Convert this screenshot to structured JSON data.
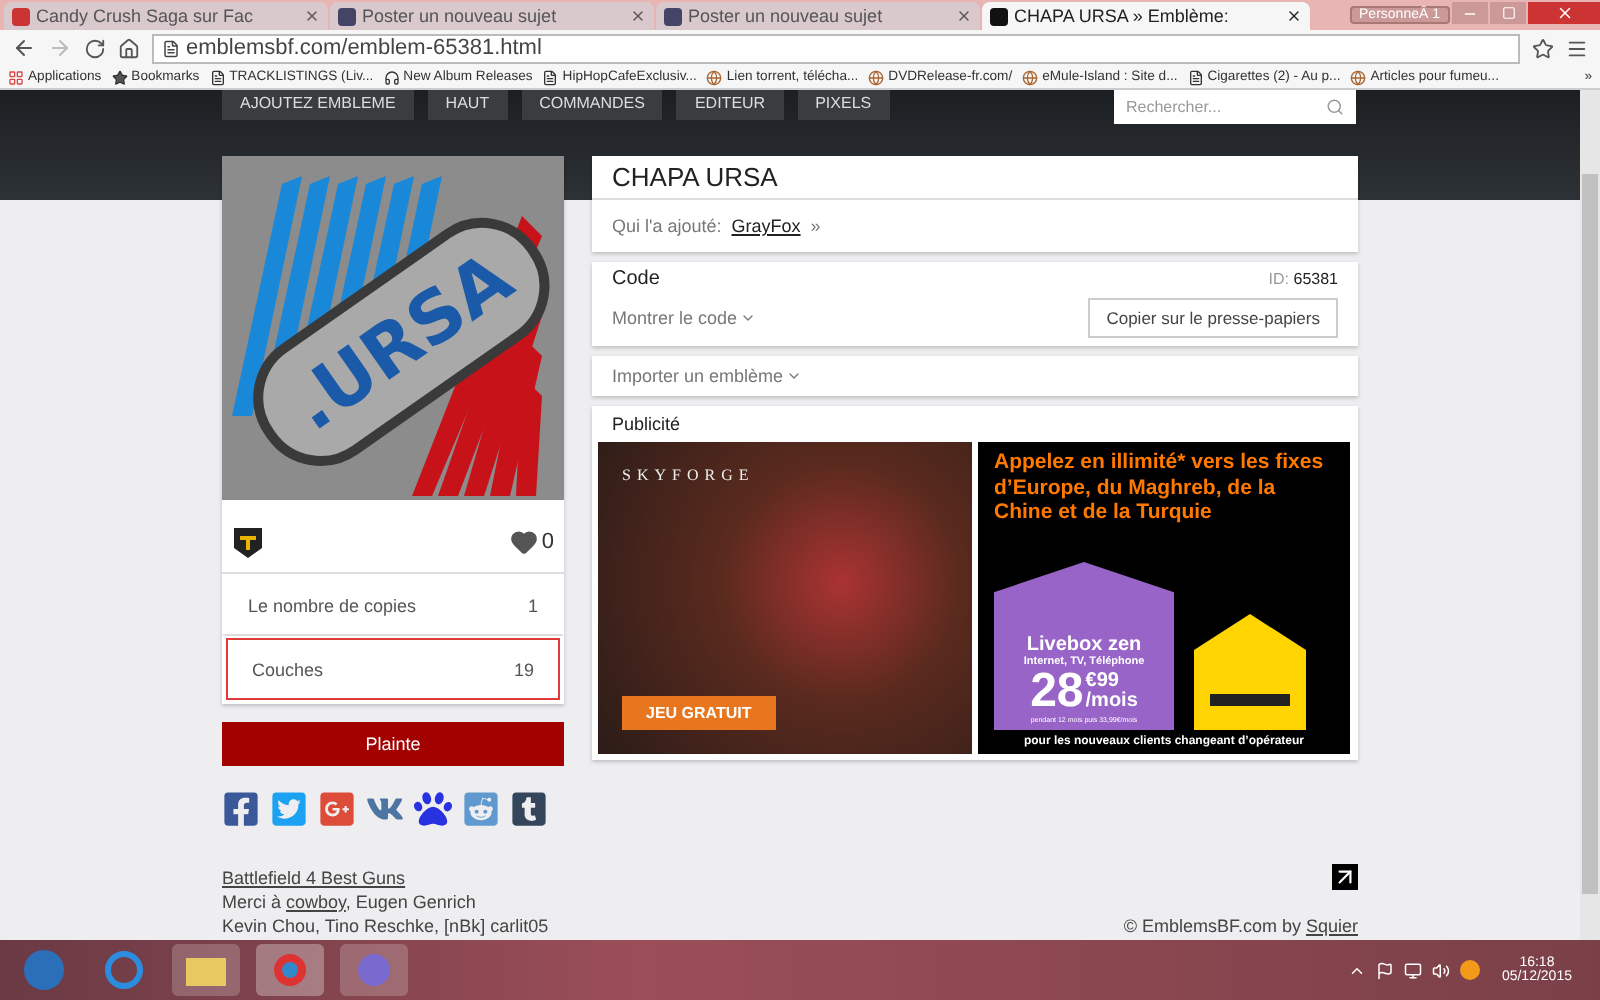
{
  "browser": {
    "tabs": [
      {
        "label": "Candy Crush Saga sur Fac",
        "selected": false
      },
      {
        "label": "Poster un nouveau sujet",
        "selected": false
      },
      {
        "label": "Poster un nouveau sujet",
        "selected": false
      },
      {
        "label": "CHAPA URSA » Emblème:",
        "selected": true
      }
    ],
    "profile": "PersonneÂ 1",
    "url": "emblemsbf.com/emblem-65381.html",
    "bookmarks": [
      {
        "label": "Applications",
        "kind": "apps"
      },
      {
        "label": "Bookmarks",
        "kind": "star"
      },
      {
        "label": "TRACKLISTINGS (Liv...",
        "kind": "page"
      },
      {
        "label": "New Album Releases",
        "kind": "headphones"
      },
      {
        "label": "HipHopCafeExclusiv...",
        "kind": "page"
      },
      {
        "label": "Lien torrent, télécha...",
        "kind": "site"
      },
      {
        "label": "DVDRelease-fr.com/",
        "kind": "site"
      },
      {
        "label": "eMule-Island : Site d...",
        "kind": "site"
      },
      {
        "label": "Cigarettes (2) - Au p...",
        "kind": "page"
      },
      {
        "label": "Articles pour fumeu...",
        "kind": "site"
      }
    ],
    "bookmarks_more": "»"
  },
  "nav": {
    "items": [
      "AJOUTEZ EMBLEME",
      "HAUT",
      "COMMANDES",
      "EDITEUR",
      "PIXELS"
    ],
    "search": {
      "placeholder": "Rechercher..."
    }
  },
  "emblem": {
    "tag_text": ".URSA",
    "likes": "0",
    "stats": [
      {
        "label": "Le nombre de copies",
        "value": "1",
        "selected": false
      },
      {
        "label": "Couches",
        "value": "19",
        "selected": true
      }
    ],
    "report_button": "Plainte"
  },
  "title": "CHAPA URSA",
  "added_by": {
    "label": "Qui l'a ajouté:",
    "user": "GrayFox",
    "suffix": "»"
  },
  "code": {
    "heading": "Code",
    "id_label": "ID:",
    "id": "65381",
    "toggle": "Montrer le code",
    "copy_button": "Copier sur le presse-papiers"
  },
  "import": "Importer un emblème",
  "ads": {
    "heading": "Publicité",
    "game": {
      "brand": "SKYFORGE",
      "button": "JEU GRATUIT"
    },
    "telecom": {
      "headline": "Appelez en illimité* vers les fixes d’Europe, du Maghreb, de la Chine et de la Turquie",
      "product": "Livebox zen",
      "services": "Internet, TV, Téléphone",
      "price": "28",
      "cents": "€99",
      "per": "/mois",
      "fine_print": "pendant 12 mois puis 33,99€/mois",
      "footer": "pour les nouveaux clients changeant d’opérateur"
    }
  },
  "footer": {
    "link": "Battlefield 4 Best Guns",
    "thanks_prefix": "Merci à",
    "thanks_user": "cowboy",
    "thanks_rest": ", Eugen Genrich",
    "thanks_line2": "Kevin Chou, Tino Reschke, [nBk] carlit05",
    "copyright": "© EmblemsBF.com by",
    "author": "Squier"
  },
  "taskbar": {
    "time": "16:18",
    "date": "05/12/2015"
  }
}
